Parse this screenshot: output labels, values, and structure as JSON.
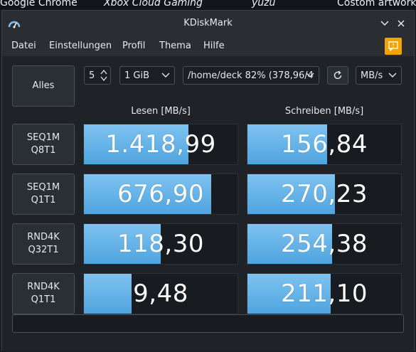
{
  "desktop": {
    "labels": [
      "Google Chrome",
      "Xbox Cloud Gaming",
      "yuzu",
      "Costom artwork"
    ]
  },
  "window": {
    "title": "KDiskMark",
    "menu": [
      "Datei",
      "Einstellungen",
      "Profil",
      "Thema",
      "Hilfe"
    ]
  },
  "controls": {
    "all_label": "Alles",
    "runs": "5",
    "size": "1 GiB",
    "path": "/home/deck 82% (378,96/4",
    "unit": "MB/s"
  },
  "columns": {
    "read": "Lesen [MB/s]",
    "write": "Schreiben [MB/s]"
  },
  "tests": [
    {
      "label_line1": "SEQ1M",
      "label_line2": "Q8T1",
      "read": "1.418,99",
      "read_fill": 0.68,
      "write": "156,84",
      "write_fill": 0.52
    },
    {
      "label_line1": "SEQ1M",
      "label_line2": "Q1T1",
      "read": "676,90",
      "read_fill": 0.83,
      "write": "270,23",
      "write_fill": 0.57
    },
    {
      "label_line1": "RND4K",
      "label_line2": "Q32T1",
      "read": "118,30",
      "read_fill": 0.5,
      "write": "254,38",
      "write_fill": 0.55
    },
    {
      "label_line1": "RND4K",
      "label_line2": "Q1T1",
      "read": "9,48",
      "read_fill": 0.31,
      "write": "211,10",
      "write_fill": 0.54
    }
  ],
  "colors": {
    "accent_bar": "#4fa4e0",
    "notify": "#f2a300"
  }
}
